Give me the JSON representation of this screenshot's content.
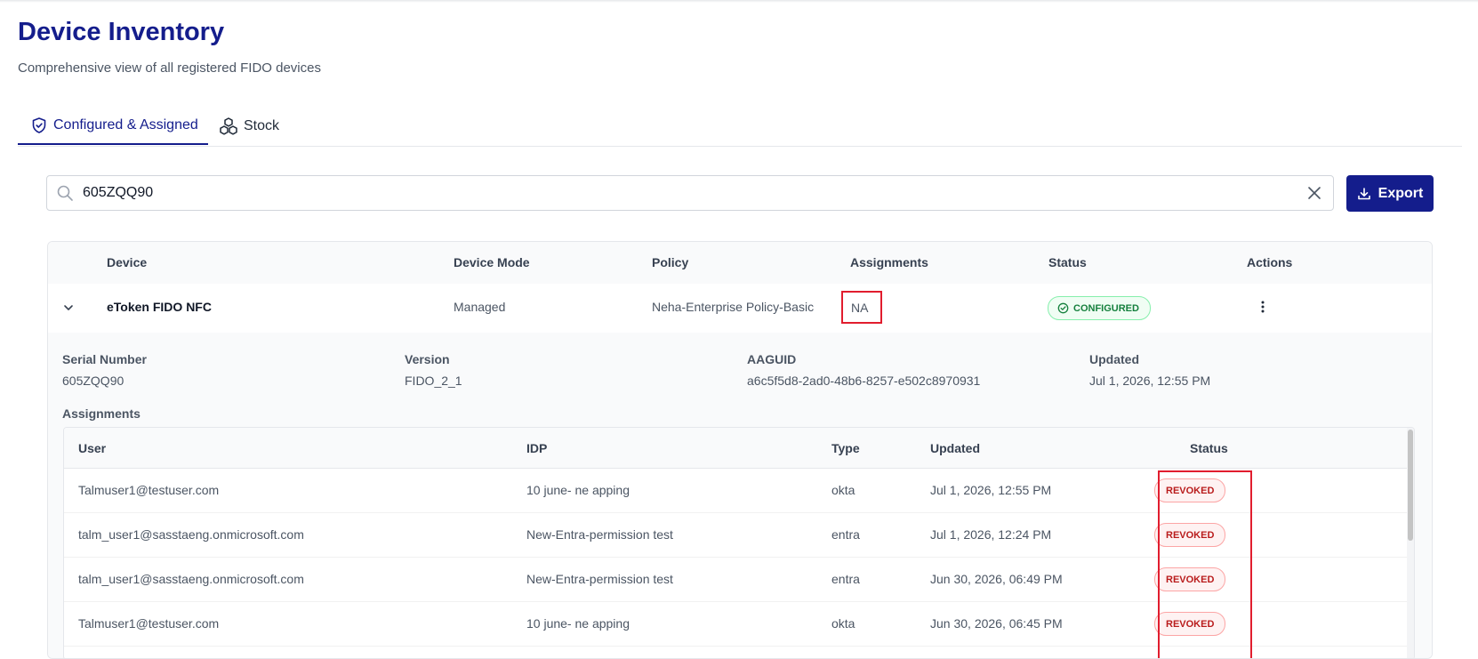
{
  "page": {
    "title": "Device Inventory",
    "subtitle": "Comprehensive view of all registered FIDO devices"
  },
  "tabs": [
    {
      "label": "Configured & Assigned",
      "icon": "shield-check-icon",
      "active": true
    },
    {
      "label": "Stock",
      "icon": "cubes-icon",
      "active": false
    }
  ],
  "search": {
    "value": "605ZQQ90",
    "icon": "search-icon",
    "clear_icon": "close-icon"
  },
  "export_button": {
    "label": "Export",
    "icon": "download-icon"
  },
  "device_table": {
    "columns": [
      "Device",
      "Device Mode",
      "Policy",
      "Assignments",
      "Status",
      "Actions"
    ],
    "row": {
      "device": "eToken FIDO NFC",
      "mode": "Managed",
      "policy": "Neha-Enterprise Policy-Basic",
      "assignments": "NA",
      "status": "CONFIGURED",
      "status_color": "#15803d"
    }
  },
  "details": {
    "serial_label": "Serial Number",
    "serial_value": "605ZQQ90",
    "version_label": "Version",
    "version_value": "FIDO_2_1",
    "aaguid_label": "AAGUID",
    "aaguid_value": "a6c5f5d8-2ad0-48b6-8257-e502c8970931",
    "updated_label": "Updated",
    "updated_value": "Jul 1, 2026, 12:55 PM",
    "assignments_label": "Assignments"
  },
  "assignments_table": {
    "columns": [
      "User",
      "IDP",
      "Type",
      "Updated",
      "Status"
    ],
    "rows": [
      {
        "user": "Talmuser1@testuser.com",
        "idp": "10 june- ne apping",
        "type": "okta",
        "updated": "Jul 1, 2026, 12:55 PM",
        "status": "REVOKED"
      },
      {
        "user": "talm_user1@sasstaeng.onmicrosoft.com",
        "idp": "New-Entra-permission test",
        "type": "entra",
        "updated": "Jul 1, 2026, 12:24 PM",
        "status": "REVOKED"
      },
      {
        "user": "talm_user1@sasstaeng.onmicrosoft.com",
        "idp": "New-Entra-permission test",
        "type": "entra",
        "updated": "Jun 30, 2026, 06:49 PM",
        "status": "REVOKED"
      },
      {
        "user": "Talmuser1@testuser.com",
        "idp": "10 june- ne apping",
        "type": "okta",
        "updated": "Jun 30, 2026, 06:45 PM",
        "status": "REVOKED"
      }
    ]
  },
  "colors": {
    "brand": "#141d8c",
    "highlight": "#e11d2e",
    "revoked": "#b91c1c"
  }
}
